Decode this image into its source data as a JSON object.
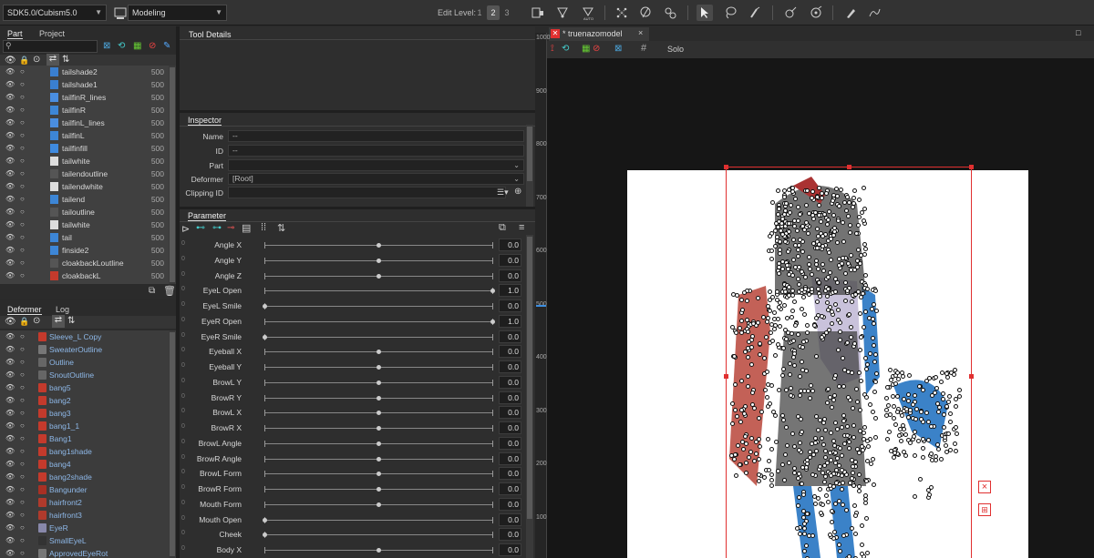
{
  "toolbar": {
    "sdk_select": "SDK5.0/Cubism5.0",
    "mode_select": "Modeling",
    "edit_level_label": "Edit Level:",
    "levels": [
      "1",
      "2",
      "3"
    ]
  },
  "parts_panel": {
    "tabs": [
      "Part",
      "Project"
    ],
    "items": [
      {
        "label": "tailshade2",
        "value": "500",
        "color": "#3a7fd0"
      },
      {
        "label": "tailshade1",
        "value": "500",
        "color": "#3a7fd0"
      },
      {
        "label": "tailfinR_lines",
        "value": "500",
        "color": "#4a8ee0"
      },
      {
        "label": "tailfinR",
        "value": "500",
        "color": "#3d86d6"
      },
      {
        "label": "tailfinL_lines",
        "value": "500",
        "color": "#4a8ee0"
      },
      {
        "label": "tailfinL",
        "value": "500",
        "color": "#3d86d6"
      },
      {
        "label": "tailfinfill",
        "value": "500",
        "color": "#3f8be0"
      },
      {
        "label": "tailwhite",
        "value": "500",
        "color": "#dddddd"
      },
      {
        "label": "tailendoutline",
        "value": "500",
        "color": "#555555"
      },
      {
        "label": "tailendwhite",
        "value": "500",
        "color": "#dddddd"
      },
      {
        "label": "tailend",
        "value": "500",
        "color": "#3d86d6"
      },
      {
        "label": "tailoutline",
        "value": "500",
        "color": "#555555"
      },
      {
        "label": "tailwhite",
        "value": "500",
        "color": "#dddddd"
      },
      {
        "label": "tail",
        "value": "500",
        "color": "#3d86d6"
      },
      {
        "label": "finside2",
        "value": "500",
        "color": "#3d86d6"
      },
      {
        "label": "cloakbackLoutline",
        "value": "500",
        "color": "#555555"
      },
      {
        "label": "cloakbackL",
        "value": "500",
        "color": "#c43a2c"
      }
    ]
  },
  "deformer_panel": {
    "tabs": [
      "Deformer",
      "Log"
    ],
    "items": [
      {
        "label": "Sleeve_L Copy",
        "color": "#c43a2c"
      },
      {
        "label": "SweaterOutline",
        "color": "#777777"
      },
      {
        "label": "Outline",
        "color": "#666666"
      },
      {
        "label": "SnoutOutline",
        "color": "#666666"
      },
      {
        "label": "bang5",
        "color": "#c43a2c"
      },
      {
        "label": "bang2",
        "color": "#c43a2c"
      },
      {
        "label": "bang3",
        "color": "#c43a2c"
      },
      {
        "label": "bang1_1",
        "color": "#c43a2c"
      },
      {
        "label": "Bang1",
        "color": "#c43a2c"
      },
      {
        "label": "bang1shade",
        "color": "#c43a2c"
      },
      {
        "label": "bang4",
        "color": "#c43a2c"
      },
      {
        "label": "bang2shade",
        "color": "#c43a2c"
      },
      {
        "label": "Bangunder",
        "color": "#a83024"
      },
      {
        "label": "hairfront2",
        "color": "#b03a2c"
      },
      {
        "label": "hairfront3",
        "color": "#b03a2c"
      },
      {
        "label": "EyeR",
        "color": "#8888aa"
      },
      {
        "label": "SmallEyeL",
        "color": "#333333"
      },
      {
        "label": "ApprovedEyeRot",
        "color": "#777777"
      }
    ]
  },
  "tool_details": {
    "tab": "Tool Details"
  },
  "inspector": {
    "tab": "Inspector",
    "name_label": "Name",
    "name_value": "--",
    "id_label": "ID",
    "id_value": "--",
    "part_label": "Part",
    "part_value": "",
    "deformer_label": "Deformer",
    "deformer_value": "[Root]",
    "clipping_label": "Clipping ID",
    "clipping_value": ""
  },
  "parameters": {
    "tab": "Parameter",
    "items": [
      {
        "label": "Angle X",
        "value": "0.0",
        "pos": 0.5,
        "zero": "0"
      },
      {
        "label": "Angle Y",
        "value": "0.0",
        "pos": 0.5,
        "zero": "0"
      },
      {
        "label": "Angle Z",
        "value": "0.0",
        "pos": 0.5,
        "zero": "0"
      },
      {
        "label": "EyeL Open",
        "value": "1.0",
        "pos": 1.0,
        "zero": "0"
      },
      {
        "label": "EyeL Smile",
        "value": "0.0",
        "pos": 0.0,
        "zero": "0"
      },
      {
        "label": "EyeR Open",
        "value": "1.0",
        "pos": 1.0,
        "zero": "0"
      },
      {
        "label": "EyeR Smile",
        "value": "0.0",
        "pos": 0.0,
        "zero": "0"
      },
      {
        "label": "Eyeball X",
        "value": "0.0",
        "pos": 0.5,
        "zero": "0"
      },
      {
        "label": "Eyeball Y",
        "value": "0.0",
        "pos": 0.5,
        "zero": "0"
      },
      {
        "label": "BrowL Y",
        "value": "0.0",
        "pos": 0.5,
        "zero": "0"
      },
      {
        "label": "BrowR Y",
        "value": "0.0",
        "pos": 0.5,
        "zero": "0"
      },
      {
        "label": "BrowL X",
        "value": "0.0",
        "pos": 0.5,
        "zero": "0"
      },
      {
        "label": "BrowR X",
        "value": "0.0",
        "pos": 0.5,
        "zero": "0"
      },
      {
        "label": "BrowL Angle",
        "value": "0.0",
        "pos": 0.5,
        "zero": "0"
      },
      {
        "label": "BrowR Angle",
        "value": "0.0",
        "pos": 0.5,
        "zero": "0"
      },
      {
        "label": "BrowL Form",
        "value": "0.0",
        "pos": 0.5,
        "zero": "0"
      },
      {
        "label": "BrowR Form",
        "value": "0.0",
        "pos": 0.5,
        "zero": "0"
      },
      {
        "label": "Mouth Form",
        "value": "0.0",
        "pos": 0.5,
        "zero": "0"
      },
      {
        "label": "Mouth Open",
        "value": "0.0",
        "pos": 0.0,
        "zero": "0"
      },
      {
        "label": "Cheek",
        "value": "0.0",
        "pos": 0.0,
        "zero": "0"
      },
      {
        "label": "Body X",
        "value": "0.0",
        "pos": 0.5,
        "zero": "0"
      }
    ]
  },
  "viewport": {
    "tab": "* truenazomodel",
    "solo_label": "Solo",
    "ruler_ticks": [
      "1000",
      "900",
      "800",
      "700",
      "600",
      "500",
      "400",
      "300",
      "200",
      "100"
    ],
    "accent": "#e03030"
  }
}
